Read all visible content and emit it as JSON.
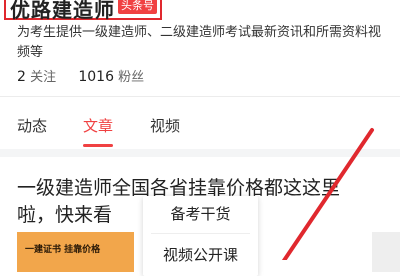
{
  "profile": {
    "name": "优路建造师",
    "badge": "头条号",
    "bio": "为考生提供一级建造师、二级建造师考试最新资讯和所需资料视频等",
    "following_count": "2",
    "following_label": "关注",
    "fans_count": "1016",
    "fans_label": "粉丝"
  },
  "tabs": [
    {
      "label": "动态",
      "active": false
    },
    {
      "label": "文章",
      "active": true
    },
    {
      "label": "视频",
      "active": false
    }
  ],
  "article": {
    "title": "一级建造师全国各省挂靠价格都这这里啦，快来看",
    "thumbnail_text": "一建证书 挂靠价格"
  },
  "popup_menu": {
    "items": [
      "备考干货",
      "视频公开课"
    ]
  },
  "colors": {
    "accent": "#f04142",
    "highlight_box": "#e0282e",
    "thumbnail_bg": "#f2a64b"
  }
}
